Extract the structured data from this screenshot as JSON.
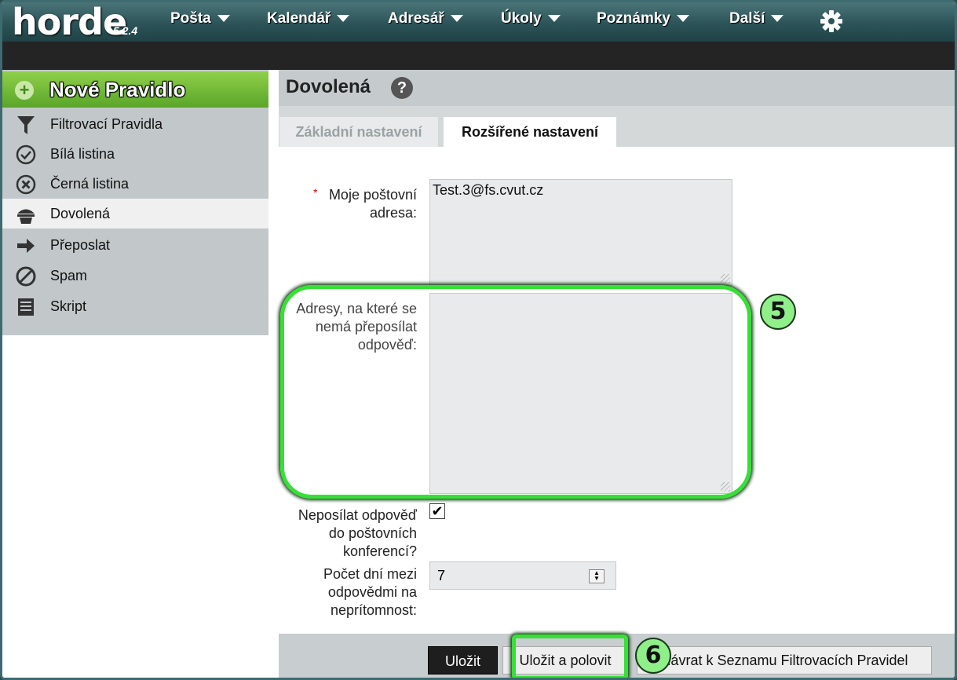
{
  "app": {
    "logo": "horde",
    "version": "5.2.4"
  },
  "topnav": [
    {
      "label": "Pošta"
    },
    {
      "label": "Kalendář"
    },
    {
      "label": "Adresář"
    },
    {
      "label": "Úkoly"
    },
    {
      "label": "Poznámky"
    },
    {
      "label": "Další"
    }
  ],
  "sidebar": {
    "new_rule": "Nové Pravidlo",
    "items": [
      {
        "label": "Filtrovací Pravidla",
        "icon": "funnel-icon"
      },
      {
        "label": "Bílá listina",
        "icon": "check-circle-icon"
      },
      {
        "label": "Černá listina",
        "icon": "x-circle-icon"
      },
      {
        "label": "Dovolená",
        "icon": "vacation-icon",
        "active": true
      },
      {
        "label": "Přeposlat",
        "icon": "arrow-right-icon"
      },
      {
        "label": "Spam",
        "icon": "prohibited-icon"
      },
      {
        "label": "Skript",
        "icon": "script-icon"
      }
    ]
  },
  "main": {
    "title": "Dovolená",
    "tabs": [
      {
        "label": "Základní nastavení",
        "active": false
      },
      {
        "label": "Rozšířené nastavení",
        "active": true
      }
    ],
    "form": {
      "required_mark": "*",
      "my_address_label_1": "Moje poštovní",
      "my_address_label_2": "adresa:",
      "my_address_value": "Test.3@fs.cvut.cz",
      "exclude_label_1": "Adresy, na které se",
      "exclude_label_2": "nemá přeposílat",
      "exclude_label_3": "odpověď:",
      "exclude_value": "",
      "nolist_label_1": "Neposílat odpověď",
      "nolist_label_2": "do poštovních",
      "nolist_label_3": "konferencí?",
      "nolist_checked": "✔",
      "days_label_1": "Počet dní mezi",
      "days_label_2": "odpovědmi na",
      "days_label_3": "neprítomnost:",
      "days_value": "7"
    },
    "buttons": {
      "save": "Uložit",
      "save_enable": "Uložit a polovit",
      "back": "Návrat k Seznamu Filtrovacích Pravidel"
    }
  },
  "annotations": {
    "step5": "5",
    "step6": "6",
    "highlight_color": "#36e036"
  }
}
